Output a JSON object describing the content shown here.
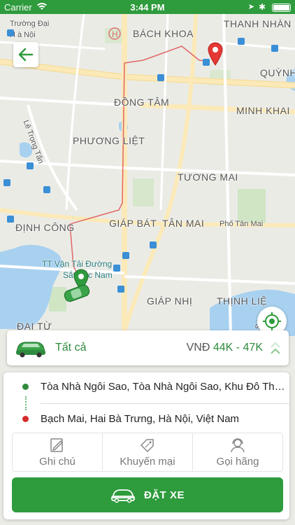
{
  "status_bar": {
    "carrier": "Carrier",
    "time": "3:44 PM"
  },
  "map": {
    "labels": {
      "truong_dai": "Trường Đại",
      "h_a_noi": "H   à Nội",
      "bach_khoa": "BÁCH KHOA",
      "thanh_nhan": "THANH NHÀN",
      "quynh": "QUỲNH",
      "dong_tam": "ĐỒNG TÂM",
      "minh_khai": "MINH KHAI",
      "le_trong_tan": "Lê Trọng Tấn",
      "phuong_liet": "PHƯƠNG LIỆT",
      "tuong_mai": "TƯƠNG MAI",
      "dinh_cong": "ĐỊNH CÔNG",
      "giap_bat": "GIÁP BÁT",
      "tan_mai": "TÂN MAI",
      "pho_tan_mai": "Phố Tân Mai",
      "tt_van_tai_1": "TT Vận Tải Đường",
      "tt_van_tai_2": "Sắt Bắc Nam",
      "giap_nhi": "GIÁP NHỊ",
      "thinh_liet": "THỊNH LIỆ",
      "dai_tu": "ĐẠI TỪ",
      "sd": "Sd"
    }
  },
  "vehicle": {
    "type_label": "Tất cả",
    "currency": "VNĐ",
    "price_range": "44K - 47K"
  },
  "route": {
    "pickup": "Tòa Nhà Ngôi Sao, Tòa Nhà Ngôi Sao, Khu Đô Thị Đ...",
    "dropoff": "Bạch Mai, Hai Bà Trưng, Hà Nội, Việt Nam"
  },
  "options": [
    {
      "label": "Ghi chú",
      "icon": "note-icon"
    },
    {
      "label": "Khuyến mại",
      "icon": "promo-tag-icon"
    },
    {
      "label": "Gọi hãng",
      "icon": "support-agent-icon"
    }
  ],
  "book_button": {
    "label": "ĐẶT XE",
    "icon": "car-icon"
  },
  "colors": {
    "brand_green": "#2e9b3d",
    "route_red": "#e06666",
    "pickup_dot": "#2e8b3d",
    "dropoff_dot": "#d62b2b"
  }
}
